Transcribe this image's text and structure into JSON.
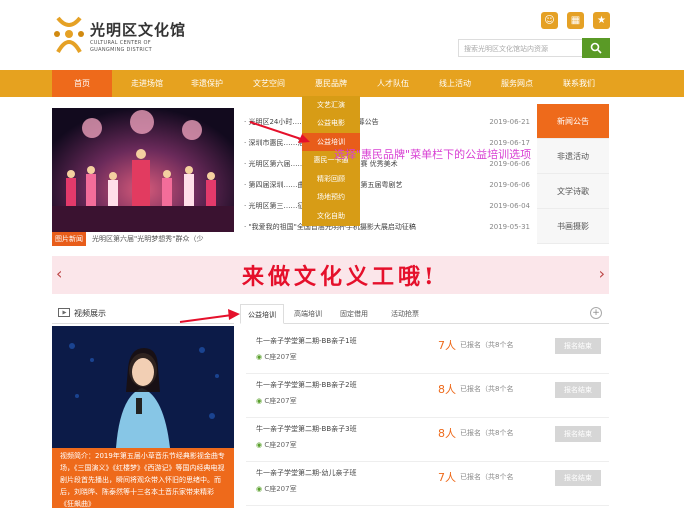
{
  "header": {
    "logo_cn": "光明区文化馆",
    "logo_en_line1": "CULTURAL CENTER OF",
    "logo_en_line2": "GUANGMING DISTRICT",
    "search_placeholder": "搜索光明区文化馆站内资源",
    "icons": [
      "user-icon",
      "qr-icon",
      "star-icon"
    ]
  },
  "nav": {
    "items": [
      "首页",
      "走进场馆",
      "非遗保护",
      "文艺空间",
      "惠民品牌",
      "人才队伍",
      "线上活动",
      "服务网点",
      "联系我们"
    ]
  },
  "dropdown": {
    "items": [
      "文艺汇演",
      "公益电影",
      "公益培训",
      "惠民一卡通",
      "精彩回顾",
      "场地预约",
      "文化自助"
    ],
    "highlighted": "公益培训"
  },
  "slider": {
    "tag": "图片新闻",
    "caption": "光明区第六届\"光明梦想秀\"群众（少"
  },
  "notices": [
    {
      "title": "光明区24小时……（剧）需求点 招募公告",
      "date": "2019-06-21"
    },
    {
      "title": "深圳市惠民……活动与推广活动通知",
      "date": "2019-06-17"
    },
    {
      "title": "光明区第六届……众（少儿）才艺大赛 优秀美术",
      "date": "2019-06-06"
    },
    {
      "title": "第四届深圳……曲填字评选暨光明区第五届粤剧艺",
      "date": "2019-06-06"
    },
    {
      "title": "光明区第三……征稿启事",
      "date": "2019-06-04"
    },
    {
      "title": "\"我爱我的祖国\"全国首届光明杯手机摄影大展启动征稿",
      "date": "2019-05-31"
    }
  ],
  "side_tabs": [
    "新闻公告",
    "非遗活动",
    "文学诗歌",
    "书画摄影"
  ],
  "annotation": "选择\"惠民品牌\"菜单栏下的公益培训选项",
  "banner": {
    "text": "来做文化义工哦!"
  },
  "video": {
    "heading": "视频展示",
    "desc": "视频简介：2019年第五届小草音乐节经典影视金曲专场，《三国演义》《红楼梦》《西游记》等国内经典电视剧片段首先播出，瞬间将观众带入怀旧的思绪中。而后，刘晓晔、陈泰然等十三名本土音乐家带来精彩《狂飙曲》"
  },
  "tabs": [
    "公益培训",
    "高端培训",
    "固定借用",
    "活动抢票"
  ],
  "courses": [
    {
      "name": "牛一亲子学堂第二期-BB亲子1班",
      "room": "C座207室",
      "num": "7人",
      "note": "已报名（共8个名",
      "button": "报名结束"
    },
    {
      "name": "牛一亲子学堂第二期-BB亲子2班",
      "room": "C座207室",
      "num": "8人",
      "note": "已报名（共8个名",
      "button": "报名结束"
    },
    {
      "name": "牛一亲子学堂第二期-BB亲子3班",
      "room": "C座207室",
      "num": "8人",
      "note": "已报名（共8个名",
      "button": "报名结束"
    },
    {
      "name": "牛一亲子学堂第二期-幼儿亲子班",
      "room": "C座207室",
      "num": "7人",
      "note": "已报名（共8个名",
      "button": "报名结束"
    }
  ]
}
